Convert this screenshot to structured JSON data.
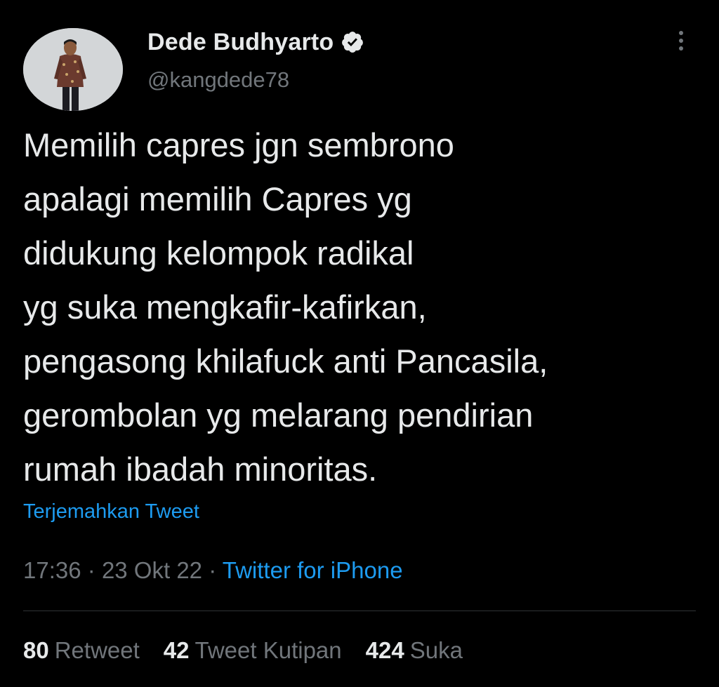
{
  "author": {
    "display_name": "Dede Budhyarto",
    "handle": "@kangdede78",
    "avatar_icon": "avatar-photo",
    "verified_icon": "verified-badge-icon"
  },
  "tweet": {
    "lines": [
      "Memilih capres jgn sembrono",
      "apalagi memilih Capres yg",
      "didukung kelompok radikal",
      "yg suka mengkafir-kafirkan,",
      "pengasong khilafuck anti Pancasila,",
      "gerombolan yg melarang pendirian",
      "rumah ibadah minoritas."
    ],
    "translate_label": "Terjemahkan Tweet"
  },
  "meta": {
    "time": "17:36",
    "separator": "·",
    "date": "23 Okt 22",
    "source": "Twitter for iPhone"
  },
  "stats": {
    "retweets_count": "80",
    "retweets_label": "Retweet",
    "quotes_count": "42",
    "quotes_label": "Tweet Kutipan",
    "likes_count": "424",
    "likes_label": "Suka"
  },
  "colors": {
    "background": "#000000",
    "text": "#e7e9ea",
    "secondary": "#71767b",
    "accent": "#1d9bf0",
    "divider": "#2f3336"
  }
}
